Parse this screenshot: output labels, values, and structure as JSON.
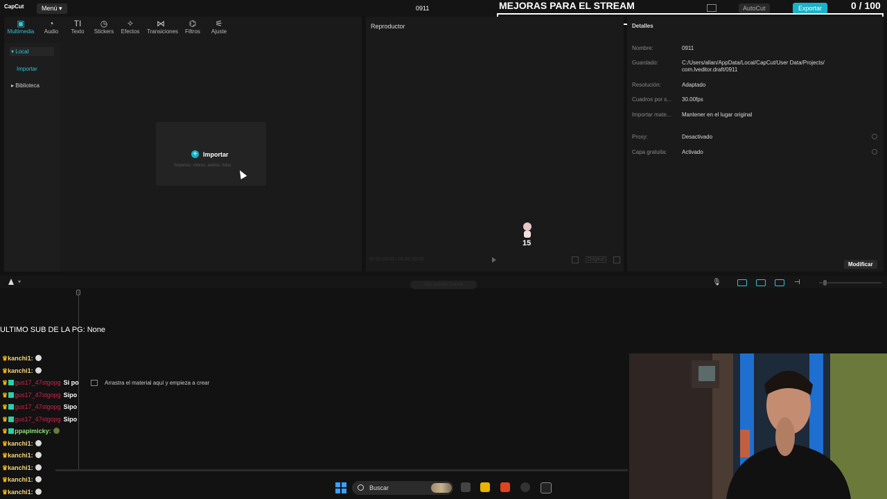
{
  "titlebar": {
    "logo": "CapCut",
    "menu_label": "Menú",
    "project_name": "0911",
    "autocut_label": "AutoCut",
    "export_label": "Exportar"
  },
  "stream_overlay": {
    "banner": "MEJORAS PARA EL STREAM",
    "counter": "0 / 100",
    "last_sub": "ULTIMO SUB DE LA PG: None",
    "chat": [
      {
        "user": "kanchi1:",
        "msg": "",
        "style": "normal"
      },
      {
        "user": "kanchi1:",
        "msg": "",
        "style": "normal"
      },
      {
        "user": "gus17_47stgopg",
        "msg": "Si po",
        "style": "red"
      },
      {
        "user": "gus17_47stgopg",
        "msg": "Sipo",
        "style": "red"
      },
      {
        "user": "gus17_47stgopg",
        "msg": "Sipo",
        "style": "red"
      },
      {
        "user": "gus17_47stgopg",
        "msg": "Sipo",
        "style": "red"
      },
      {
        "user": "ppapimicky:",
        "msg": "",
        "style": "green"
      },
      {
        "user": "kanchi1:",
        "msg": "",
        "style": "normal"
      },
      {
        "user": "kanchi1:",
        "msg": "",
        "style": "normal"
      },
      {
        "user": "kanchi1:",
        "msg": "",
        "style": "normal"
      },
      {
        "user": "kanchi1:",
        "msg": "",
        "style": "normal"
      },
      {
        "user": "kanchi1:",
        "msg": "",
        "style": "normal"
      }
    ]
  },
  "media_panel": {
    "tabs": [
      {
        "label": "Multimedia",
        "icon": "media-icon",
        "glyph": "▣",
        "active": true
      },
      {
        "label": "Audio",
        "icon": "audio-icon",
        "glyph": "◔",
        "active": false
      },
      {
        "label": "Texto",
        "icon": "text-icon",
        "glyph": "TI",
        "active": false
      },
      {
        "label": "Stickers",
        "icon": "sticker-icon",
        "glyph": "◷",
        "active": false
      },
      {
        "label": "Efectos",
        "icon": "effects-icon",
        "glyph": "✧",
        "active": false
      },
      {
        "label": "Transiciones",
        "icon": "transitions-icon",
        "glyph": "⋈",
        "active": false
      },
      {
        "label": "Filtros",
        "icon": "filters-icon",
        "glyph": "⌬",
        "active": false
      },
      {
        "label": "Ajuste",
        "icon": "adjust-icon",
        "glyph": "⚟",
        "active": false
      }
    ],
    "sidebar": {
      "local": "Local",
      "import": "Importar",
      "library": "Biblioteca"
    },
    "import_box": {
      "label": "Importar",
      "sub": "Soportes: vídeos, audios, fotos"
    }
  },
  "player": {
    "title": "Reproductor",
    "time": "00:00:00:00 / 00:00:00:00",
    "original_label": "Original"
  },
  "details": {
    "title": "Detalles",
    "rows": [
      {
        "label": "Nombre:",
        "value": "0911"
      },
      {
        "label": "Guardado:",
        "value": "C:/Users/allan/AppData/Local/CapCut/User Data/Projects/ com.lveditor.draft/0911"
      },
      {
        "label": "Resolución:",
        "value": "Adaptado"
      },
      {
        "label": "Cuadros por s...",
        "value": "30.00fps"
      },
      {
        "label": "Importar mate...",
        "value": "Mantener en el lugar original"
      },
      {
        "label": "Proxy:",
        "value": "Desactivado"
      },
      {
        "label": "Capa gratuita:",
        "value": "Activado"
      }
    ],
    "modify_label": "Modificar"
  },
  "timeline": {
    "pill_text": "Solo guardar licencia",
    "hint": "Arrastra el material aquí y empieza a crear"
  },
  "taskbar": {
    "search_label": "Buscar"
  },
  "colors": {
    "accent": "#17b3c9",
    "background": "#121212",
    "panel": "#1a1a1a"
  }
}
